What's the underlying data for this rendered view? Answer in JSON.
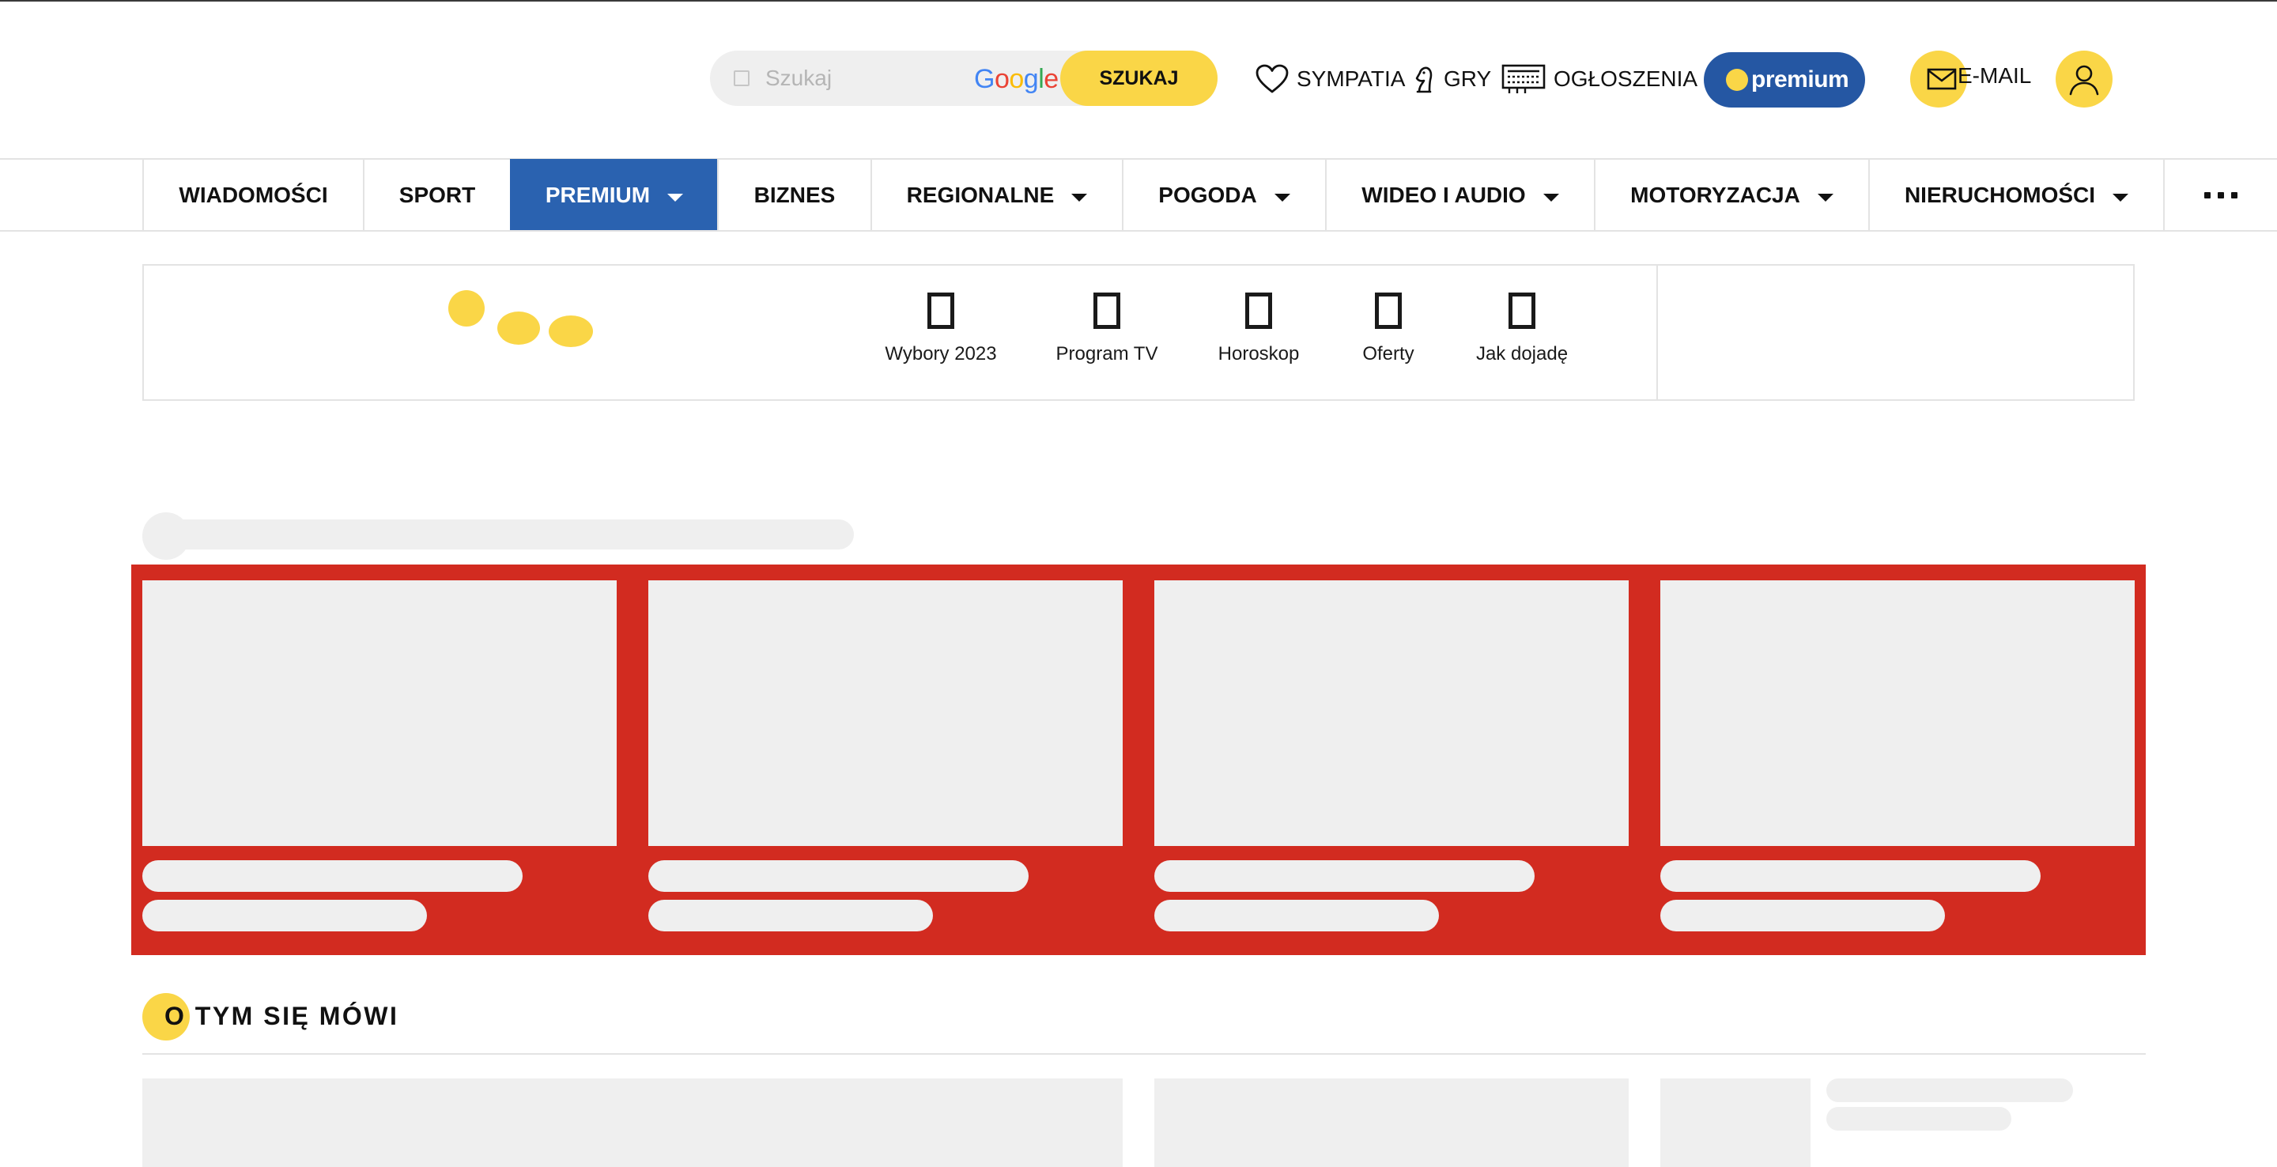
{
  "header": {
    "search": {
      "placeholder": "Szukaj",
      "provider_logo": "Google",
      "button_label": "SZUKAJ"
    },
    "links": [
      {
        "label": "SYMPATIA",
        "icon": "heart-icon"
      },
      {
        "label": "GRY",
        "icon": "chess-knight-icon"
      },
      {
        "label": "OGŁOSZENIA",
        "icon": "classifieds-icon"
      }
    ],
    "premium_label": "premium",
    "email_label": "E-MAIL",
    "avatar_icon": "user-icon"
  },
  "nav": {
    "items": [
      {
        "label": "WIADOMOŚCI",
        "dropdown": false,
        "active": false
      },
      {
        "label": "SPORT",
        "dropdown": false,
        "active": false
      },
      {
        "label": "PREMIUM",
        "dropdown": true,
        "active": true
      },
      {
        "label": "BIZNES",
        "dropdown": false,
        "active": false
      },
      {
        "label": "REGIONALNE",
        "dropdown": true,
        "active": false
      },
      {
        "label": "POGODA",
        "dropdown": true,
        "active": false
      },
      {
        "label": "WIDEO I AUDIO",
        "dropdown": true,
        "active": false
      },
      {
        "label": "MOTORYZACJA",
        "dropdown": true,
        "active": false
      },
      {
        "label": "NIERUCHOMOŚCI",
        "dropdown": true,
        "active": false
      }
    ],
    "more_icon": "more-dots-icon"
  },
  "services": [
    {
      "label": "Wybory 2023"
    },
    {
      "label": "Program TV"
    },
    {
      "label": "Horoskop"
    },
    {
      "label": "Oferty"
    },
    {
      "label": "Jak dojadę"
    }
  ],
  "section": {
    "title_initial": "O",
    "title_rest": " TYM SIĘ MÓWI"
  },
  "colors": {
    "accent_yellow": "#fad647",
    "premium_blue": "#2557a3",
    "nav_active_blue": "#2a62b0",
    "band_red": "#d22b20",
    "skeleton": "#efefef"
  }
}
